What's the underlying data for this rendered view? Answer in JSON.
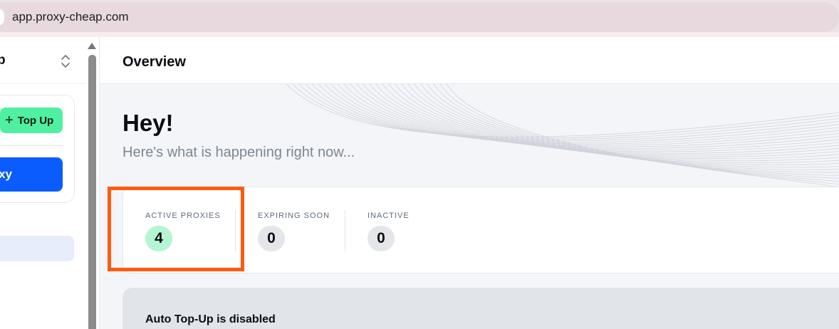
{
  "browser": {
    "url": "app.proxy-cheap.com"
  },
  "sidebar": {
    "title_partial": "p",
    "topup_label": "Top Up",
    "proxy_button_partial": "xy"
  },
  "header": {
    "title": "Overview"
  },
  "hero": {
    "greeting": "Hey!",
    "subtitle": "Here's what is happening right now..."
  },
  "stats": [
    {
      "label": "ACTIVE PROXIES",
      "value": "4",
      "accent": "#b4f5d3"
    },
    {
      "label": "EXPIRING SOON",
      "value": "0",
      "accent": "#e4e6ea"
    },
    {
      "label": "INACTIVE",
      "value": "0",
      "accent": "#e4e6ea"
    }
  ],
  "auto_topup": {
    "status_text": "Auto Top-Up is disabled"
  },
  "colors": {
    "highlight": "#ff5a0e",
    "topup_green": "#4ff0a0",
    "primary_blue": "#0b5cff"
  }
}
